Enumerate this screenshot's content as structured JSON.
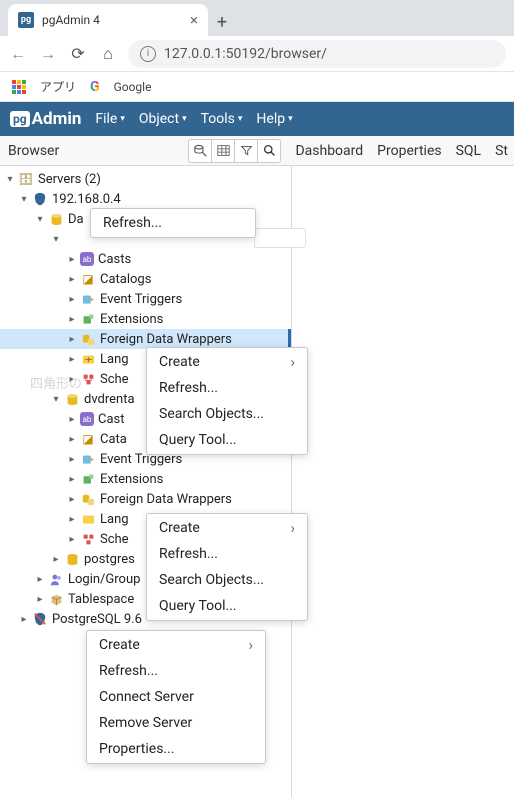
{
  "browser_tab": {
    "title": "pgAdmin 4",
    "favicon_text": "pg"
  },
  "address": {
    "url": "127.0.0.1:50192/browser/"
  },
  "bookmarks": {
    "apps": "アプリ",
    "google": "Google"
  },
  "pga": {
    "logo_box": "pg",
    "logo_text": "Admin",
    "menu": {
      "file": "File",
      "object": "Object",
      "tools": "Tools",
      "help": "Help"
    }
  },
  "panel": {
    "title": "Browser",
    "tabs": {
      "dashboard": "Dashboard",
      "properties": "Properties",
      "sql": "SQL",
      "st": "St"
    }
  },
  "tree": {
    "servers": "Servers (2)",
    "host": "192.168.0.4",
    "da": "Da",
    "casts": "Casts",
    "catalogs": "Catalogs",
    "event_triggers": "Event Triggers",
    "extensions": "Extensions",
    "fdw": "Foreign Data Wrappers",
    "lang": "Lang",
    "sche": "Sche",
    "dvdrental": "dvdrenta",
    "cast2": "Cast",
    "cata2": "Cata",
    "evt2": "Event Triggers",
    "ext2": "Extensions",
    "fdw2": "Foreign Data Wrappers",
    "lang2": "Lang",
    "sche2": "Sche",
    "postgres": "postgres",
    "login": "Login/Group",
    "tablespaces": "Tablespace",
    "pg96": "PostgreSQL 9.6"
  },
  "menus": {
    "refresh": "Refresh...",
    "create": "Create",
    "search_objects": "Search Objects...",
    "query_tool": "Query Tool...",
    "connect_server": "Connect Server",
    "remove_server": "Remove Server",
    "properties": "Properties..."
  },
  "watermark": "四角形の"
}
